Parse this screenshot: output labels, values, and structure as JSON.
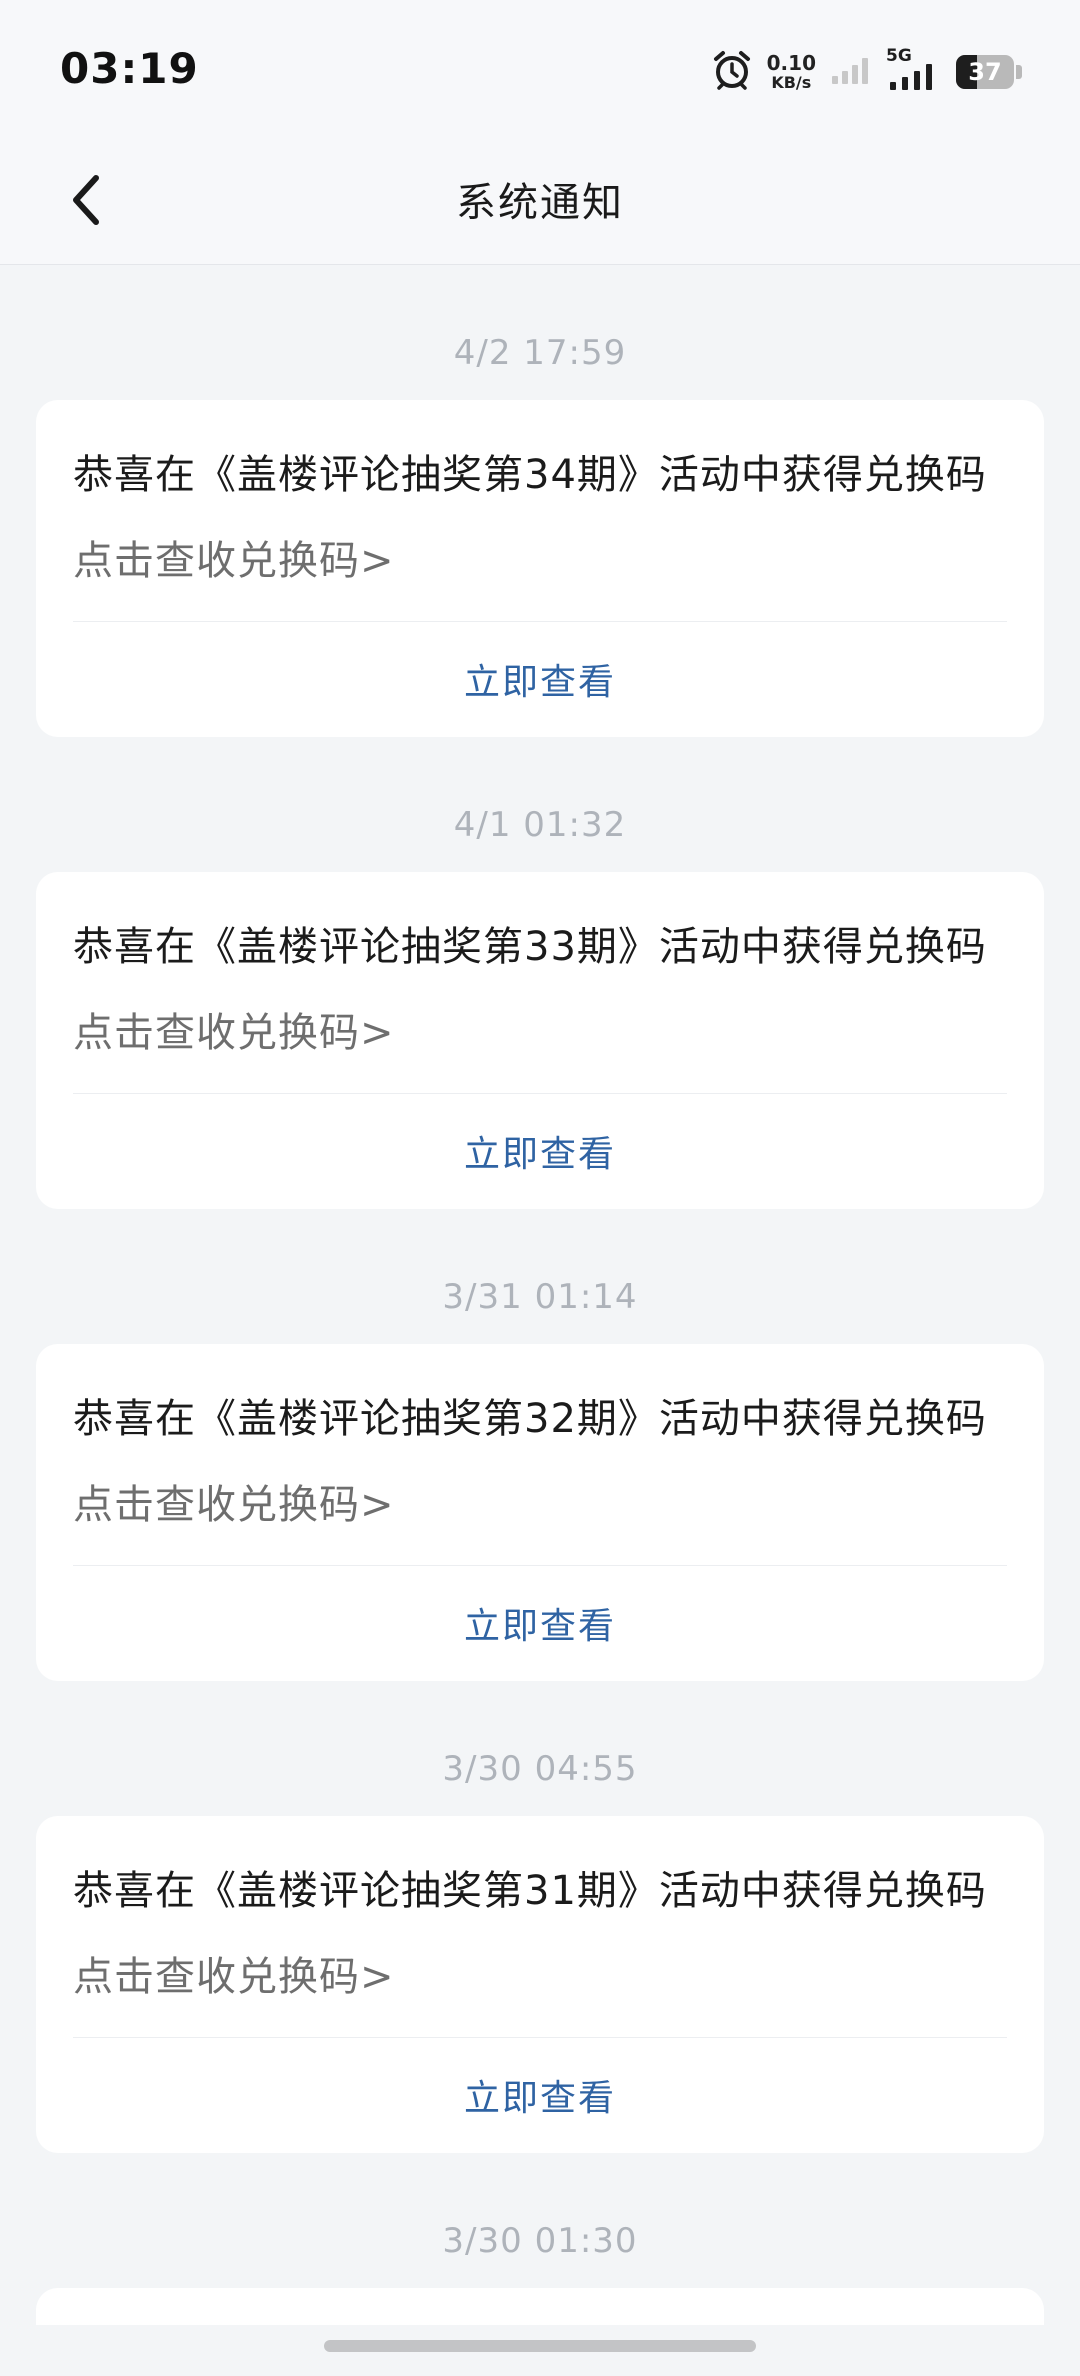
{
  "status_bar": {
    "time": "03:19",
    "net_speed_value": "0.10",
    "net_speed_unit": "KB/s",
    "network_type": "5G",
    "battery_level": "37",
    "battery_fraction": 0.37
  },
  "header": {
    "title": "系统通知"
  },
  "notifications": [
    {
      "time": "4/2  17:59",
      "title": "恭喜在《盖楼评论抽奖第34期》活动中获得兑换码",
      "subtitle": "点击查收兑换码>",
      "action": "立即查看"
    },
    {
      "time": "4/1  01:32",
      "title": "恭喜在《盖楼评论抽奖第33期》活动中获得兑换码",
      "subtitle": "点击查收兑换码>",
      "action": "立即查看"
    },
    {
      "time": "3/31  01:14",
      "title": "恭喜在《盖楼评论抽奖第32期》活动中获得兑换码",
      "subtitle": "点击查收兑换码>",
      "action": "立即查看"
    },
    {
      "time": "3/30  04:55",
      "title": "恭喜在《盖楼评论抽奖第31期》活动中获得兑换码",
      "subtitle": "点击查收兑换码>",
      "action": "立即查看"
    },
    {
      "time": "3/30  01:30"
    }
  ],
  "colors": {
    "background": "#f3f5f7",
    "accent_link": "#2f63a3",
    "timestamp": "#aeb3ba"
  }
}
